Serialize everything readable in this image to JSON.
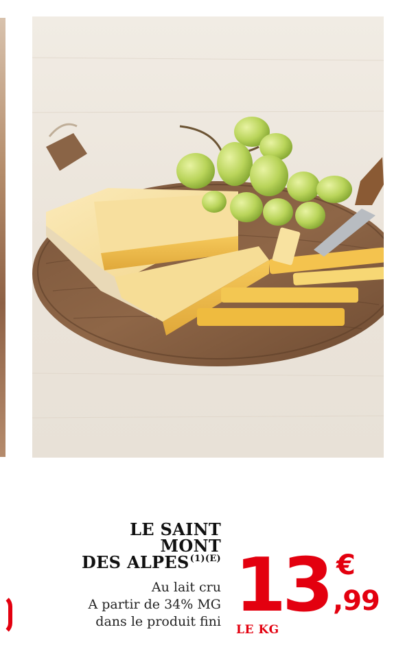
{
  "product": {
    "title_line1": "LE SAINT",
    "title_line2": "MONT",
    "title_line3": "DES ALPES",
    "title_superscript": "(1)(E)",
    "description_line1": "Au lait cru",
    "description_line2": "A partir de 34% MG",
    "description_line3": "dans le produit fini"
  },
  "price": {
    "integer": "13",
    "currency": "€",
    "decimals": ",99",
    "unit": "LE KG",
    "color": "#e3000f"
  },
  "photo": {
    "subject": "cheese-board-with-grapes-and-knife"
  }
}
